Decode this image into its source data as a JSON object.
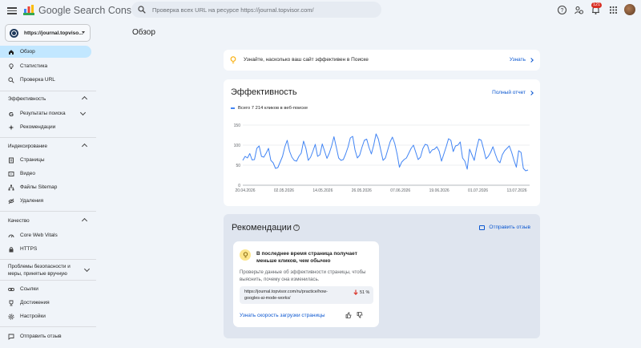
{
  "header": {
    "logo_text": "Google Search Console",
    "search_placeholder": "Проверка всех URL на ресурсе https://journal.topvisor.com/",
    "notifications_count": "121"
  },
  "sidebar": {
    "property": "https://journal.topviso...",
    "top_items": [
      {
        "label": "Обзор",
        "icon": "home-icon",
        "active": true
      },
      {
        "label": "Статистика",
        "icon": "lightbulb-icon"
      },
      {
        "label": "Проверка URL",
        "icon": "search-icon"
      }
    ],
    "sections": {
      "performance": {
        "title": "Эффективность",
        "items": [
          {
            "label": "Результаты поиска",
            "icon": "google-g-icon"
          },
          {
            "label": "Рекомендации",
            "icon": "sparkle-icon"
          }
        ]
      },
      "indexing": {
        "title": "Индексирование",
        "items": [
          {
            "label": "Страницы",
            "icon": "pages-icon"
          },
          {
            "label": "Видео",
            "icon": "video-icon"
          },
          {
            "label": "Файлы Sitemap",
            "icon": "sitemap-icon"
          },
          {
            "label": "Удаления",
            "icon": "removals-icon"
          }
        ]
      },
      "experience": {
        "title": "Качество",
        "items": [
          {
            "label": "Core Web Vitals",
            "icon": "gauge-icon"
          },
          {
            "label": "HTTPS",
            "icon": "lock-icon"
          }
        ]
      },
      "security": {
        "title": "Проблемы безопасности и меры, принятые вручную",
        "items": []
      },
      "other": {
        "items": [
          {
            "label": "Ссылки",
            "icon": "links-icon"
          },
          {
            "label": "Достижения",
            "icon": "trophy-icon"
          },
          {
            "label": "Настройки",
            "icon": "settings-icon"
          }
        ]
      },
      "feedback": {
        "label": "Отправить отзыв",
        "icon": "feedback-icon"
      }
    }
  },
  "main": {
    "page_title": "Обзор",
    "banner": {
      "text": "Узнайте, насколько ваш сайт эффективен в Поиске",
      "link": "Узнать"
    },
    "performance": {
      "title": "Эффективность",
      "link": "Полный отчет",
      "legend": "Всего 7 214 кликов в веб-поиске"
    },
    "recommendations": {
      "title": "Рекомендации",
      "feedback_link": "Отправить отзыв",
      "card": {
        "title": "В последнее время страница получает меньше кликов, чем обычно",
        "description": "Проверьте данные об эффективности страницы, чтобы выяснить, почему она изменилась.",
        "url": "https://journal.topvisor.com/ru/practice/how-googles-ai-mode-works/",
        "change": "51 %",
        "link": "Узнать скорость загрузки страницы"
      }
    }
  },
  "colors": {
    "accent": "#0b57d0",
    "series": "#4285f4",
    "active_nav": "#c2e7ff"
  },
  "chart_data": {
    "type": "line",
    "series": [
      {
        "name": "Всего 7 214 кликов в веб-поиске",
        "values": [
          62,
          72,
          68,
          79,
          63,
          64,
          92,
          98,
          72,
          70,
          80,
          92,
          62,
          56,
          42,
          44,
          58,
          72,
          96,
          112,
          85,
          70,
          62,
          60,
          72,
          80,
          110,
          92,
          62,
          70,
          85,
          102,
          72,
          76,
          103,
          85,
          67,
          80,
          98,
          121,
          95,
          68,
          62,
          64,
          78,
          95,
          118,
          122,
          88,
          68,
          75,
          95,
          112,
          115,
          94,
          78,
          100,
          128,
          115,
          88,
          62,
          68,
          88,
          108,
          120,
          104,
          78,
          45,
          58,
          64,
          68,
          80,
          92,
          100,
          82,
          64,
          70,
          91,
          102,
          100,
          80,
          88,
          90,
          96,
          85,
          60,
          78,
          96,
          116,
          112,
          84,
          98,
          100,
          108,
          68,
          60,
          40,
          90,
          76,
          62,
          92,
          115,
          112,
          90,
          66,
          72,
          82,
          96,
          78,
          62,
          56,
          76,
          86,
          92,
          98,
          82,
          62,
          45,
          86,
          82,
          42,
          36,
          38
        ]
      }
    ],
    "x_labels": [
      "20.04.2026",
      "02.05.2026",
      "14.05.2026",
      "26.05.2026",
      "07.06.2026",
      "19.06.2026",
      "01.07.2026",
      "13.07.2026"
    ],
    "y_ticks": [
      0,
      50,
      100,
      150
    ],
    "ylim": [
      0,
      150
    ],
    "grid": true
  }
}
